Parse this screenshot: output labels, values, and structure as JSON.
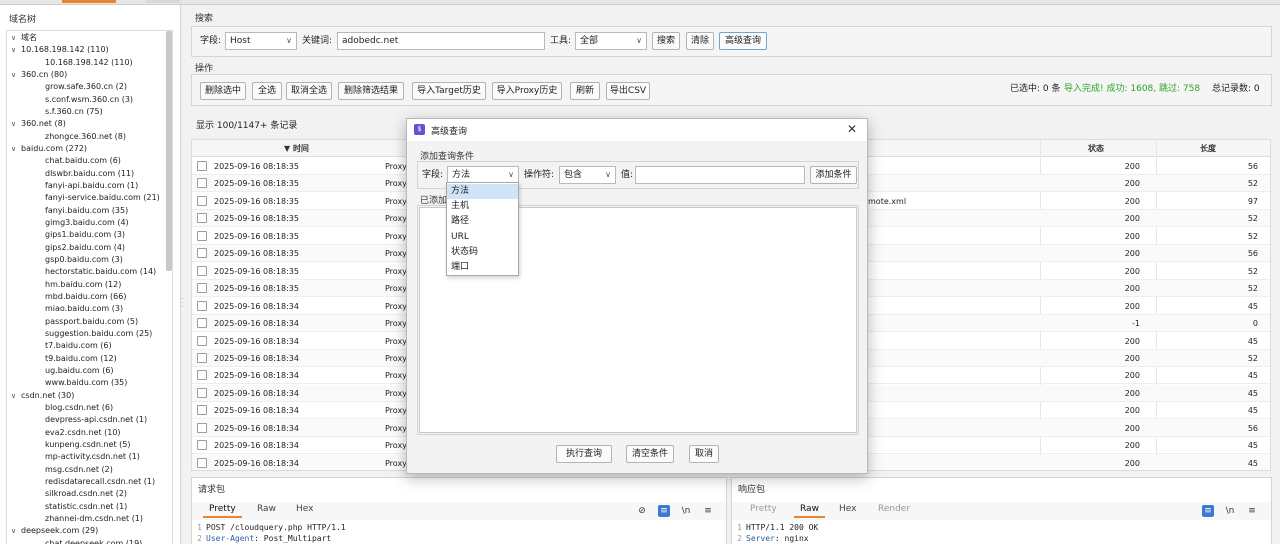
{
  "tree": {
    "title": "域名树",
    "items": [
      {
        "label": "域名",
        "level": 0,
        "chevron": "∨"
      },
      {
        "label": "10.168.198.142 (110)",
        "level": 0,
        "chevron": "∨"
      },
      {
        "label": "10.168.198.142 (110)",
        "level": 2,
        "chevron": ""
      },
      {
        "label": "360.cn (80)",
        "level": 0,
        "chevron": "∨"
      },
      {
        "label": "grow.safe.360.cn (2)",
        "level": 2,
        "chevron": ""
      },
      {
        "label": "s.conf.wsm.360.cn (3)",
        "level": 2,
        "chevron": ""
      },
      {
        "label": "s.f.360.cn (75)",
        "level": 2,
        "chevron": ""
      },
      {
        "label": "360.net (8)",
        "level": 0,
        "chevron": "∨"
      },
      {
        "label": "zhongce.360.net (8)",
        "level": 2,
        "chevron": ""
      },
      {
        "label": "baidu.com (272)",
        "level": 0,
        "chevron": "∨"
      },
      {
        "label": "chat.baidu.com (6)",
        "level": 2,
        "chevron": ""
      },
      {
        "label": "dlswbr.baidu.com (11)",
        "level": 2,
        "chevron": ""
      },
      {
        "label": "fanyi-api.baidu.com (1)",
        "level": 2,
        "chevron": ""
      },
      {
        "label": "fanyi-service.baidu.com (21)",
        "level": 2,
        "chevron": ""
      },
      {
        "label": "fanyi.baidu.com (35)",
        "level": 2,
        "chevron": ""
      },
      {
        "label": "gimg3.baidu.com (4)",
        "level": 2,
        "chevron": ""
      },
      {
        "label": "gips1.baidu.com (3)",
        "level": 2,
        "chevron": ""
      },
      {
        "label": "gips2.baidu.com (4)",
        "level": 2,
        "chevron": ""
      },
      {
        "label": "gsp0.baidu.com (3)",
        "level": 2,
        "chevron": ""
      },
      {
        "label": "hectorstatic.baidu.com (14)",
        "level": 2,
        "chevron": ""
      },
      {
        "label": "hm.baidu.com (12)",
        "level": 2,
        "chevron": ""
      },
      {
        "label": "mbd.baidu.com (66)",
        "level": 2,
        "chevron": ""
      },
      {
        "label": "miao.baidu.com (3)",
        "level": 2,
        "chevron": ""
      },
      {
        "label": "passport.baidu.com (5)",
        "level": 2,
        "chevron": ""
      },
      {
        "label": "suggestion.baidu.com (25)",
        "level": 2,
        "chevron": ""
      },
      {
        "label": "t7.baidu.com (6)",
        "level": 2,
        "chevron": ""
      },
      {
        "label": "t9.baidu.com (12)",
        "level": 2,
        "chevron": ""
      },
      {
        "label": "ug.baidu.com (6)",
        "level": 2,
        "chevron": ""
      },
      {
        "label": "www.baidu.com (35)",
        "level": 2,
        "chevron": ""
      },
      {
        "label": "csdn.net (30)",
        "level": 0,
        "chevron": "∨"
      },
      {
        "label": "blog.csdn.net (6)",
        "level": 2,
        "chevron": ""
      },
      {
        "label": "devpress-api.csdn.net (1)",
        "level": 2,
        "chevron": ""
      },
      {
        "label": "eva2.csdn.net (10)",
        "level": 2,
        "chevron": ""
      },
      {
        "label": "kunpeng.csdn.net (5)",
        "level": 2,
        "chevron": ""
      },
      {
        "label": "mp-activity.csdn.net (1)",
        "level": 2,
        "chevron": ""
      },
      {
        "label": "msg.csdn.net (2)",
        "level": 2,
        "chevron": ""
      },
      {
        "label": "redisdatarecall.csdn.net (1)",
        "level": 2,
        "chevron": ""
      },
      {
        "label": "silkroad.csdn.net (2)",
        "level": 2,
        "chevron": ""
      },
      {
        "label": "statistic.csdn.net (1)",
        "level": 2,
        "chevron": ""
      },
      {
        "label": "zhannei-dm.csdn.net (1)",
        "level": 2,
        "chevron": ""
      },
      {
        "label": "deepseek.com (29)",
        "level": 0,
        "chevron": "∨"
      },
      {
        "label": "chat.deepseek.com (19)",
        "level": 2,
        "chevron": ""
      }
    ]
  },
  "search": {
    "title": "搜索",
    "field_label": "字段:",
    "field_value": "Host",
    "keyword_label": "关键词:",
    "keyword_value": "adobedc.net",
    "tool_label": "工具:",
    "tool_value": "全部",
    "search_btn": "搜索",
    "clear_btn": "清除",
    "advanced_btn": "高级查询"
  },
  "ops": {
    "title": "操作",
    "buttons": [
      "删除选中",
      "全选",
      "取消全选",
      "删除筛选结果",
      "导入Target历史",
      "导入Proxy历史",
      "刷新",
      "导出CSV"
    ],
    "selected": "已选中: 0 条",
    "import_status": "导入完成! 成功: 1608, 跳过: 758",
    "total": "总记录数: 0",
    "success_color": "#2aa52a"
  },
  "table": {
    "summary": "显示 100/1147+ 条记录",
    "headers": {
      "time": "▼ 时间",
      "status": "状态",
      "length": "长度"
    },
    "rows": [
      {
        "time": "2025-09-16 08:18:35",
        "tool": "Proxy",
        "path": "",
        "status": "200",
        "length": "56"
      },
      {
        "time": "2025-09-16 08:18:35",
        "tool": "Proxy",
        "path": "",
        "status": "200",
        "length": "52"
      },
      {
        "time": "2025-09-16 08:18:35",
        "tool": "Proxy",
        "path": "mote.xml",
        "status": "200",
        "length": "97"
      },
      {
        "time": "2025-09-16 08:18:35",
        "tool": "Proxy",
        "path": "",
        "status": "200",
        "length": "52"
      },
      {
        "time": "2025-09-16 08:18:35",
        "tool": "Proxy",
        "path": "",
        "status": "200",
        "length": "52"
      },
      {
        "time": "2025-09-16 08:18:35",
        "tool": "Proxy",
        "path": "",
        "status": "200",
        "length": "56"
      },
      {
        "time": "2025-09-16 08:18:35",
        "tool": "Proxy",
        "path": "",
        "status": "200",
        "length": "52"
      },
      {
        "time": "2025-09-16 08:18:35",
        "tool": "Proxy",
        "path": "",
        "status": "200",
        "length": "52"
      },
      {
        "time": "2025-09-16 08:18:34",
        "tool": "Proxy",
        "path": "",
        "status": "200",
        "length": "45"
      },
      {
        "time": "2025-09-16 08:18:34",
        "tool": "Proxy",
        "path": "",
        "status": "-1",
        "length": "0"
      },
      {
        "time": "2025-09-16 08:18:34",
        "tool": "Proxy",
        "path": "",
        "status": "200",
        "length": "45"
      },
      {
        "time": "2025-09-16 08:18:34",
        "tool": "Proxy",
        "path": "",
        "status": "200",
        "length": "52"
      },
      {
        "time": "2025-09-16 08:18:34",
        "tool": "Proxy",
        "path": "",
        "status": "200",
        "length": "45"
      },
      {
        "time": "2025-09-16 08:18:34",
        "tool": "Proxy",
        "path": "",
        "status": "200",
        "length": "45"
      },
      {
        "time": "2025-09-16 08:18:34",
        "tool": "Proxy",
        "path": "",
        "status": "200",
        "length": "45"
      },
      {
        "time": "2025-09-16 08:18:34",
        "tool": "Proxy",
        "path": "",
        "status": "200",
        "length": "56"
      },
      {
        "time": "2025-09-16 08:18:34",
        "tool": "Proxy",
        "path": "",
        "status": "200",
        "length": "45"
      },
      {
        "time": "2025-09-16 08:18:34",
        "tool": "Proxy",
        "path": "",
        "status": "200",
        "length": "45"
      },
      {
        "time": "2025-09-16 08:18:34",
        "tool": "Proxy",
        "path": "",
        "status": "200",
        "length": "45"
      }
    ]
  },
  "request": {
    "title": "请求包",
    "tabs": [
      "Pretty",
      "Raw",
      "Hex"
    ],
    "lines": [
      {
        "num": "1",
        "key": "",
        "text": "POST /cloudquery.php HTTP/1.1"
      },
      {
        "num": "2",
        "key": "User-Agent",
        "text": ": Post_Multipart"
      }
    ]
  },
  "response": {
    "title": "响应包",
    "tabs": [
      "Pretty",
      "Raw",
      "Hex",
      "Render"
    ],
    "lines": [
      {
        "num": "1",
        "key": "",
        "text": "HTTP/1.1 200 OK"
      },
      {
        "num": "2",
        "key": "Server",
        "text": ": nginx"
      }
    ]
  },
  "modal": {
    "title": "高级查询",
    "logo_text": "$",
    "add_group": "添加查询条件",
    "field_label": "字段:",
    "field_value": "方法",
    "operator_label": "操作符:",
    "operator_value": "包含",
    "value_label": "值:",
    "value_placeholder": "",
    "add_btn": "添加条件",
    "added_group": "已添加",
    "run_btn": "执行查询",
    "clear_btn": "清空条件",
    "cancel_btn": "取消",
    "dropdown_options": [
      "方法",
      "主机",
      "路径",
      "URL",
      "状态码",
      "端口"
    ],
    "dropdown_selected": "方法"
  },
  "colors": {
    "accent": "#e8852f",
    "selection": "#cfe4f7",
    "icon_blue": "#3a7ad0"
  }
}
